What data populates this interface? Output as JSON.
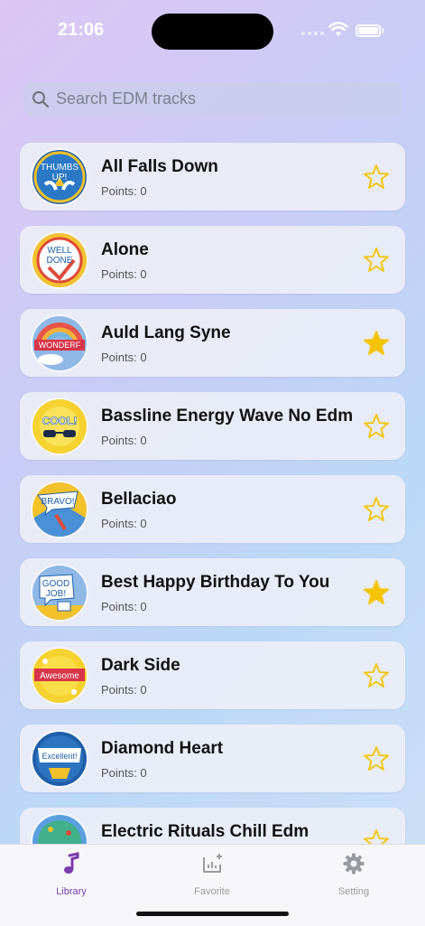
{
  "status_bar": {
    "time": "21:06"
  },
  "search": {
    "placeholder": "Search EDM tracks",
    "value": ""
  },
  "tracks": [
    {
      "title": "All Falls Down",
      "points": "Points: 0",
      "favorite": false,
      "badge_text": [
        "THUMBS",
        "UP!"
      ]
    },
    {
      "title": "Alone",
      "points": "Points: 0",
      "favorite": false,
      "badge_text": [
        "WELL",
        "DONE"
      ]
    },
    {
      "title": "Auld Lang Syne",
      "points": "Points: 0",
      "favorite": true,
      "badge_text": [
        "WONDERF"
      ]
    },
    {
      "title": "Bassline Energy Wave No Edm",
      "points": "Points: 0",
      "favorite": false,
      "badge_text": [
        "COOL!"
      ]
    },
    {
      "title": "Bellaciao",
      "points": "Points: 0",
      "favorite": false,
      "badge_text": [
        "BRAVO!"
      ]
    },
    {
      "title": "Best Happy Birthday To You",
      "points": "Points: 0",
      "favorite": true,
      "badge_text": [
        "GOOD",
        "JOB!"
      ]
    },
    {
      "title": "Dark Side",
      "points": "Points: 0",
      "favorite": false,
      "badge_text": [
        "Awesome"
      ]
    },
    {
      "title": "Diamond Heart",
      "points": "Points: 0",
      "favorite": false,
      "badge_text": [
        "Excellent!"
      ]
    },
    {
      "title": "Electric Rituals Chill Edm",
      "points": "",
      "favorite": false,
      "badge_text": []
    }
  ],
  "tabbar": {
    "tabs": [
      {
        "label": "Library",
        "icon": "music-note-icon",
        "active": true
      },
      {
        "label": "Favorite",
        "icon": "chart-plus-icon",
        "active": false
      },
      {
        "label": "Setting",
        "icon": "gear-icon",
        "active": false
      }
    ]
  },
  "colors": {
    "accent": "#7a3cad",
    "star": "#f5c400",
    "inactive_tab": "#9a9aa1"
  }
}
